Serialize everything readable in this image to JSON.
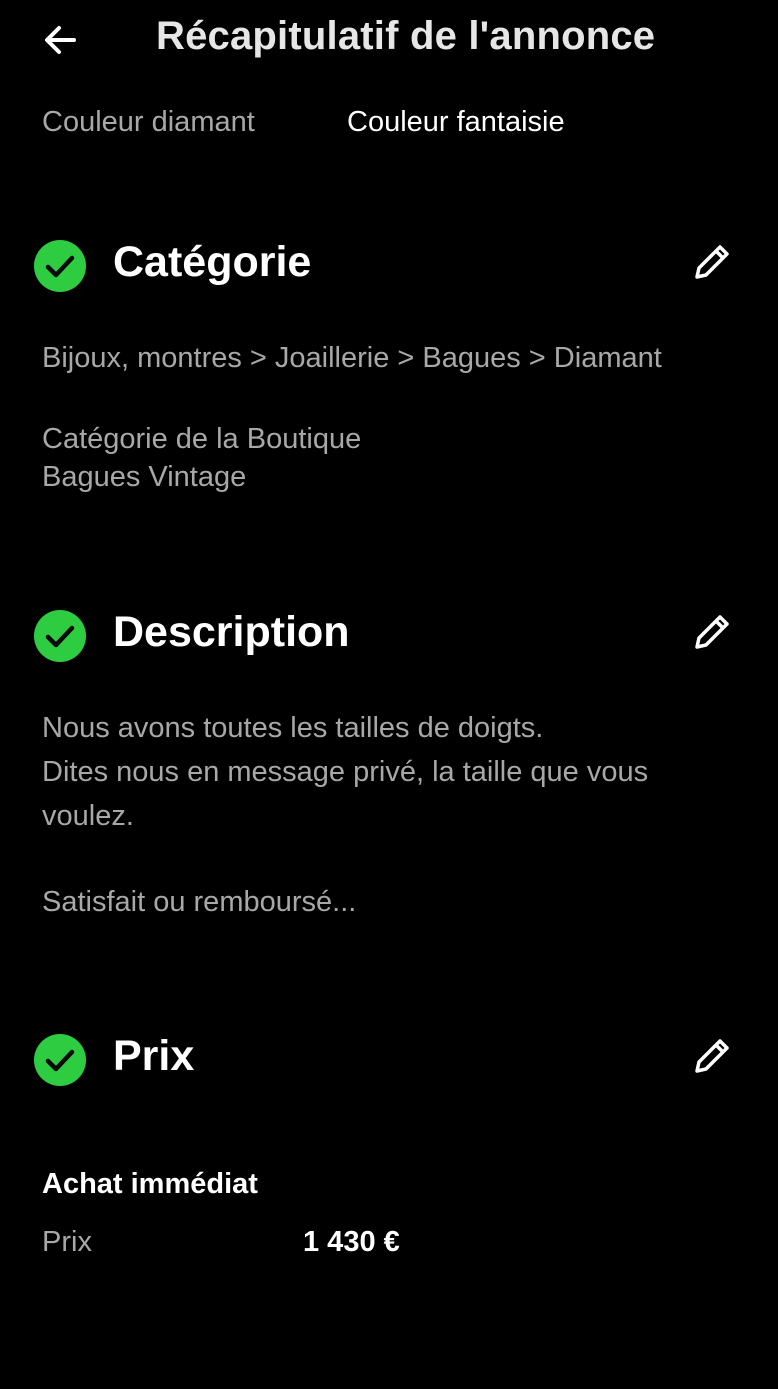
{
  "header": {
    "title": "Récapitulatif de l'annonce",
    "back_icon": "arrow-left-icon"
  },
  "specifics": {
    "label": "Couleur diamant",
    "value": "Couleur fantaisie"
  },
  "sections": {
    "category": {
      "title": "Catégorie",
      "path": "Bijoux, montres > Joaillerie > Bagues > Diamant",
      "store_category_label": "Catégorie de la Boutique",
      "store_category_value": "Bagues Vintage"
    },
    "description": {
      "title": "Description",
      "line1": "Nous avons toutes les tailles de doigts.",
      "line2": "Dites nous en message privé, la taille que vous voulez.",
      "line3": "Satisfait ou remboursé..."
    },
    "price": {
      "title": "Prix",
      "format_label": "Achat immédiat",
      "price_label": "Prix",
      "price_value": "1 430 €"
    }
  },
  "colors": {
    "background": "#000000",
    "check_green": "#2ecc40",
    "muted_text": "#a8a8a8"
  }
}
